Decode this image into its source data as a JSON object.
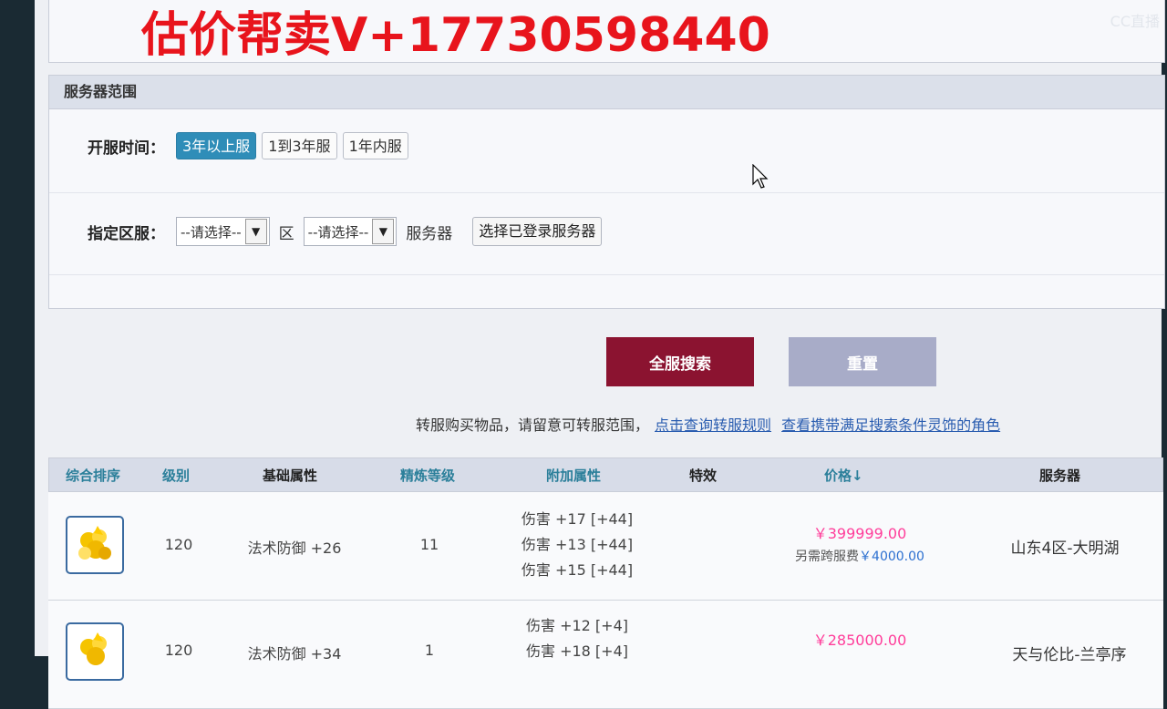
{
  "overlay": {
    "watermark": "估价帮卖V+17730598440",
    "logo": "CC直播"
  },
  "server_panel": {
    "title": "服务器范围",
    "open_time_label": "开服时间：",
    "open_time_options": [
      "3年以上服",
      "1到3年服",
      "1年内服"
    ],
    "open_time_selected": "3年以上服",
    "region_label": "指定区服：",
    "zone_select": "--请选择--",
    "zone_unit": "区",
    "server_select": "--请选择--",
    "server_unit": "服务器",
    "logged_server_button": "选择已登录服务器"
  },
  "actions": {
    "search": "全服搜索",
    "reset": "重置"
  },
  "notice": {
    "text": "转服购买物品，请留意可转服范围，",
    "link1": "点击查询转服规则",
    "link2": "查看携带满足搜索条件灵饰的角色"
  },
  "table": {
    "headers": {
      "sort": "综合排序",
      "level": "级别",
      "base_attr": "基础属性",
      "refine": "精炼等级",
      "extra_attr": "附加属性",
      "effect": "特效",
      "price": "价格↓",
      "server": "服务器"
    },
    "rows": [
      {
        "icon": "gold-accessory-icon",
        "level": "120",
        "base_attr": "法术防御 +26",
        "refine": "11",
        "extra": [
          "伤害 +17 [+44]",
          "伤害 +13 [+44]",
          "伤害 +15 [+44]"
        ],
        "price": "￥399999.00",
        "fee_label": "另需跨服费",
        "fee_value": "￥4000.00",
        "server": "山东4区-大明湖"
      },
      {
        "icon": "gold-accessory-icon",
        "level": "120",
        "base_attr": "法术防御 +34",
        "refine": "1",
        "extra": [
          "伤害 +12 [+4]",
          "伤害 +18 [+4]"
        ],
        "price": "￥285000.00",
        "server": "天与伦比-兰亭序"
      }
    ]
  },
  "colors": {
    "search_button": "#8b1330",
    "reset_button": "#a8acc8",
    "price": "#ff3d9a",
    "watermark": "#e8141c"
  }
}
